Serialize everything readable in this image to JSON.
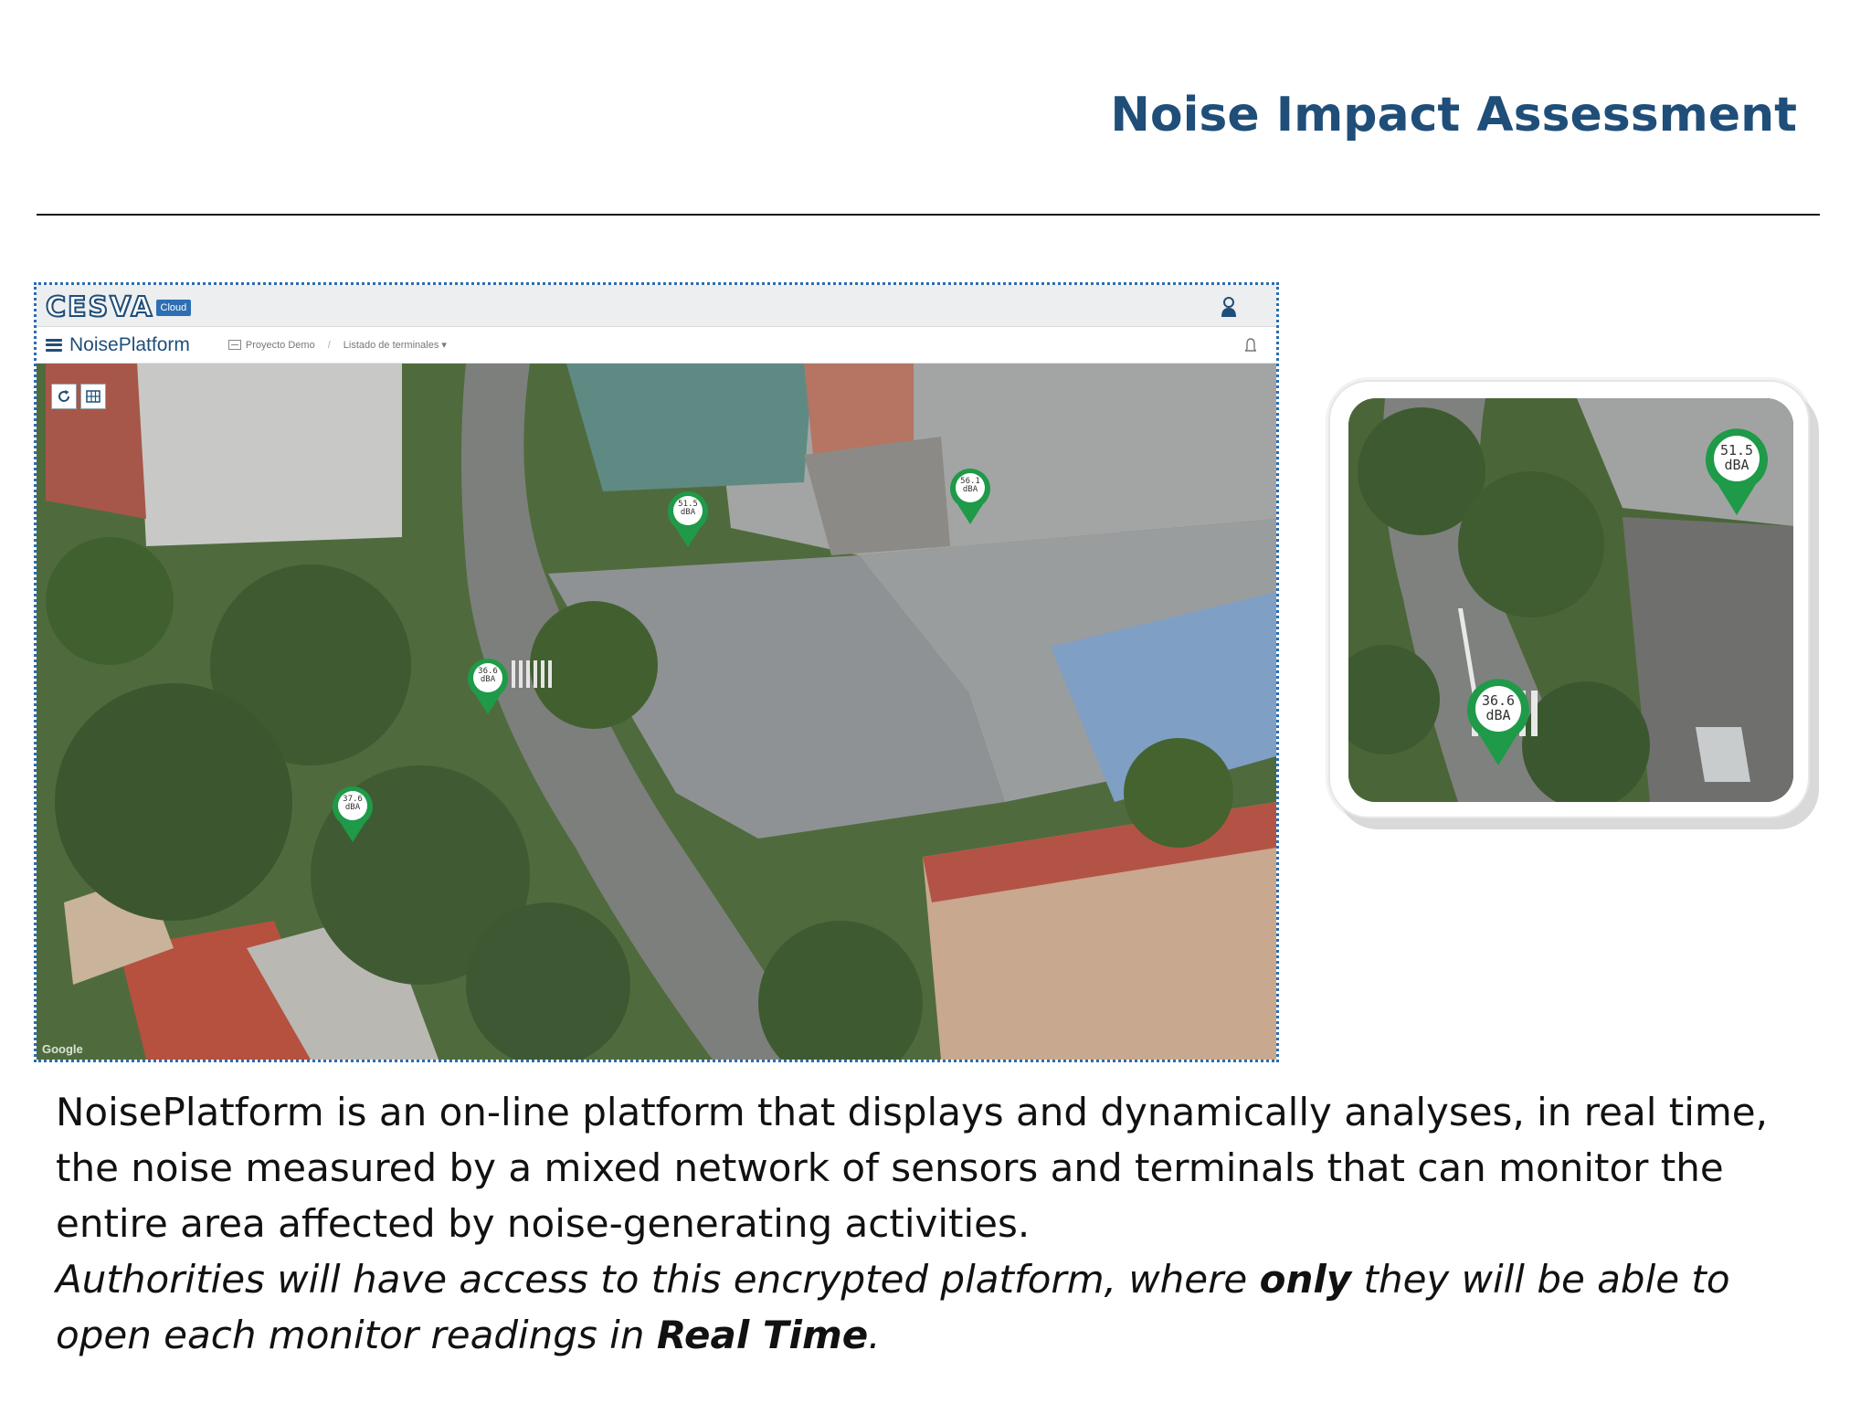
{
  "slide": {
    "title": "Noise Impact Assessment",
    "title_color": "#1f4e79"
  },
  "app": {
    "brand_name": "CESVA",
    "brand_badge": "Cloud",
    "app_name": "NoisePlatform",
    "breadcrumb_project": "Proyecto Demo",
    "breadcrumb_list": "Listado de terminales ▾",
    "map_attribution": "Google",
    "icons": [
      "menu-icon",
      "user-icon",
      "bell-icon",
      "refresh-icon",
      "grid-icon"
    ],
    "accent_color": "#2e6fb4",
    "marker_color": "#1f9a48"
  },
  "map_markers": [
    {
      "value": "51.5",
      "unit": "dBA"
    },
    {
      "value": "56.1",
      "unit": "dBA"
    },
    {
      "value": "36.6",
      "unit": "dBA"
    },
    {
      "value": "37.6",
      "unit": "dBA"
    }
  ],
  "zoom_markers": [
    {
      "value": "51.5",
      "unit": "dBA"
    },
    {
      "value": "36.6",
      "unit": "dBA"
    }
  ],
  "body": {
    "paragraph_1": "NoisePlatform is an on-line platform that displays and dynamically analyses, in real time, the noise measured by a mixed network of sensors and terminals that can monitor the entire area affected by noise-generating activities.",
    "paragraph_2_part1": "Authorities will have access to this encrypted platform, where ",
    "paragraph_2_bold1": "only",
    "paragraph_2_part2": " they will be able to open each monitor readings in ",
    "paragraph_2_bold2": "Real Time",
    "paragraph_2_end": "."
  }
}
